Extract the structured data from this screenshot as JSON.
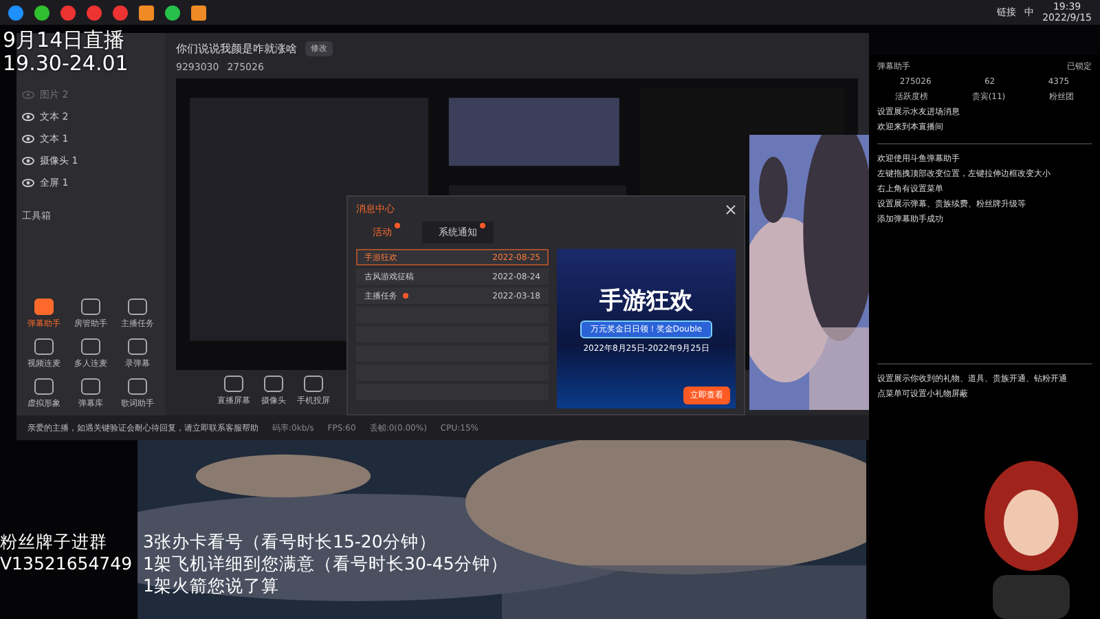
{
  "taskbar": {
    "tray_label": "链接",
    "ime": "中",
    "time": "19:39",
    "date": "2022/9/15"
  },
  "overlay_top": {
    "date_line": "9月14日直播",
    "time_line": "19.30-24.01"
  },
  "app": {
    "room_title": "你们说说我颜是咋就涨啥",
    "edit_button": "修改",
    "room_id": "9293030",
    "hot": "275026",
    "layers": [
      {
        "name": "图片 2",
        "visible": false
      },
      {
        "name": "文本 2",
        "visible": true
      },
      {
        "name": "文本 1",
        "visible": true
      },
      {
        "name": "摄像头 1",
        "visible": true
      },
      {
        "name": "全屏 1",
        "visible": true
      }
    ],
    "toolbox_title": "工具箱",
    "tools": [
      {
        "label": "弹幕助手",
        "selected": true
      },
      {
        "label": "房管助手",
        "selected": false
      },
      {
        "label": "主播任务",
        "selected": false
      },
      {
        "label": "视频连麦",
        "selected": false
      },
      {
        "label": "多人连麦",
        "selected": false
      },
      {
        "label": "录弹幕",
        "selected": false
      },
      {
        "label": "虚拟形象",
        "selected": false
      },
      {
        "label": "弹幕库",
        "selected": false
      },
      {
        "label": "歌词助手",
        "selected": false
      }
    ],
    "sources": [
      "直播屏幕",
      "摄像头",
      "手机投屏"
    ],
    "notice": "亲爱的主播，如遇关键验证会耐心待回复，请立即联系客服帮助",
    "stats": [
      "码率:0kb/s",
      "FPS:60",
      "丢帧:0(0.00%)",
      "CPU:15%"
    ]
  },
  "dialog": {
    "title": "消息中心",
    "tabs": [
      {
        "label": "活动",
        "selected": true,
        "unread": true
      },
      {
        "label": "系统通知",
        "selected": false,
        "unread": true
      }
    ],
    "rows": [
      {
        "title": "手游狂欢",
        "date": "2022-08-25",
        "selected": true,
        "unread": false
      },
      {
        "title": "古风游戏征稿",
        "date": "2022-08-24",
        "selected": false,
        "unread": false
      },
      {
        "title": "主播任务",
        "date": "2022-03-18",
        "selected": false,
        "unread": true
      }
    ],
    "banner": {
      "headline": "手游狂欢",
      "ribbon": "万元奖金日日领！奖金Double",
      "period": "2022年8月25日-2022年9月25日",
      "button": "立即查看"
    }
  },
  "danmu": {
    "title": "弹幕助手",
    "lock": "已锁定",
    "counts": [
      "275026",
      "62",
      "4375"
    ],
    "tabs": [
      "活跃度榜",
      "贵宾(11)",
      "粉丝团"
    ],
    "section_title": "设置展示水友进场消息",
    "welcome": "欢迎来到本直播间",
    "help": [
      "欢迎使用斗鱼弹幕助手",
      "左键拖拽顶部改变位置，左键拉伸边框改变大小",
      "右上角有设置菜单",
      "设置展示弹幕、贵族续费、粉丝牌升级等",
      "添加弹幕助手成功"
    ],
    "gift_help": [
      "设置展示你收到的礼物、道具、贵族开通、钻粉开通",
      "点菜单可设置小礼物屏蔽"
    ]
  },
  "overlay_bottom": {
    "left": [
      "粉丝牌子进群",
      "V13521654749"
    ],
    "right": [
      "3张办卡看号（看号时长15-20分钟）",
      "1架飞机详细到您满意（看号时长30-45分钟）",
      "1架火箭您说了算"
    ]
  }
}
